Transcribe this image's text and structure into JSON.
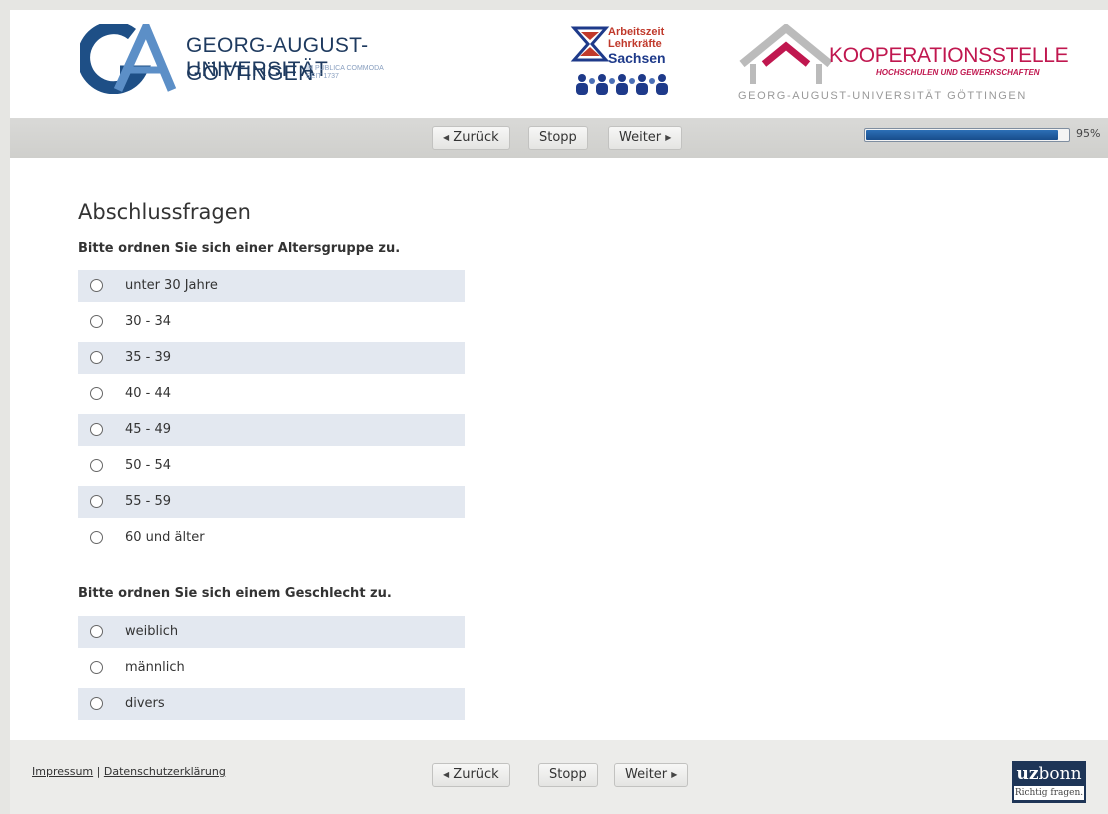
{
  "header": {
    "ga_line1": "GEORG-AUGUST-UNIVERSITÄT",
    "ga_line2": "GÖTTINGEN",
    "ga_motto1": "IN PUBLICA COMMODA",
    "ga_motto2": "SEIT 1737",
    "alas_line1": "Arbeitszeit",
    "alas_line2": "Lehrkräfte",
    "alas_line3": "Sachsen",
    "koop_title": "KOOPERATIONSSTELLE",
    "koop_sub": "HOCHSCHULEN UND GEWERKSCHAFTEN",
    "koop_ga": "GEORG-AUGUST-UNIVERSITÄT GÖTTINGEN"
  },
  "nav": {
    "back": "Zurück",
    "stop": "Stopp",
    "next": "Weiter",
    "progress_percent": 95,
    "progress_label": "95%"
  },
  "main": {
    "title": "Abschlussfragen",
    "q1": "Bitte ordnen Sie sich einer Altersgruppe zu.",
    "age_options": [
      "unter 30 Jahre",
      "30 - 34",
      "35 - 39",
      "40 - 44",
      "45 - 49",
      "50 - 54",
      "55 - 59",
      "60 und älter"
    ],
    "q2": "Bitte ordnen Sie sich einem Geschlecht zu.",
    "gender_options": [
      "weiblich",
      "männlich",
      "divers"
    ]
  },
  "footer": {
    "impressum": "Impressum",
    "separator": "|",
    "datenschutz": "Datenschutzerklärung",
    "brand_bold": "uz",
    "brand_rest": "bonn",
    "brand_tagline": "Richtig fragen."
  },
  "colors": {
    "brand_blue": "#1e3a5f",
    "koop_red": "#c0174f",
    "progress": "#2c6fb6",
    "row_shade": "#e3e8f0"
  }
}
